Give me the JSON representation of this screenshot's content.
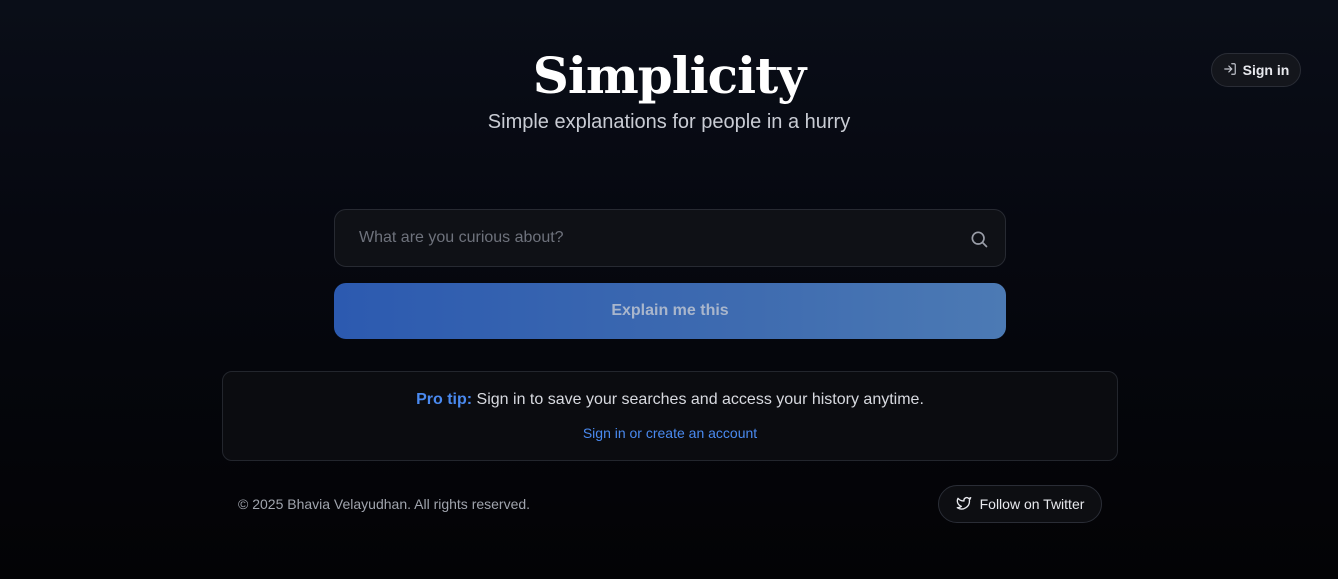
{
  "header": {
    "title": "Simplicity",
    "subtitle": "Simple explanations for people in a hurry",
    "signin_label": "Sign in"
  },
  "search": {
    "placeholder": "What are you curious about?",
    "value": "",
    "submit_label": "Explain me this"
  },
  "tip": {
    "label": "Pro tip:",
    "text": " Sign in to save your searches and access your history anytime.",
    "link_label": "Sign in or create an account"
  },
  "footer": {
    "copyright": "© 2025 Bhavia Velayudhan. All rights reserved.",
    "twitter_label": "Follow on Twitter"
  },
  "icons": {
    "signin": "sign-in-icon",
    "search": "search-icon",
    "twitter": "twitter-icon"
  },
  "colors": {
    "accent": "#4a8af0",
    "button_gradient_start": "#2c5ab0",
    "button_gradient_end": "#4c7ab4",
    "background": "#05060a"
  }
}
